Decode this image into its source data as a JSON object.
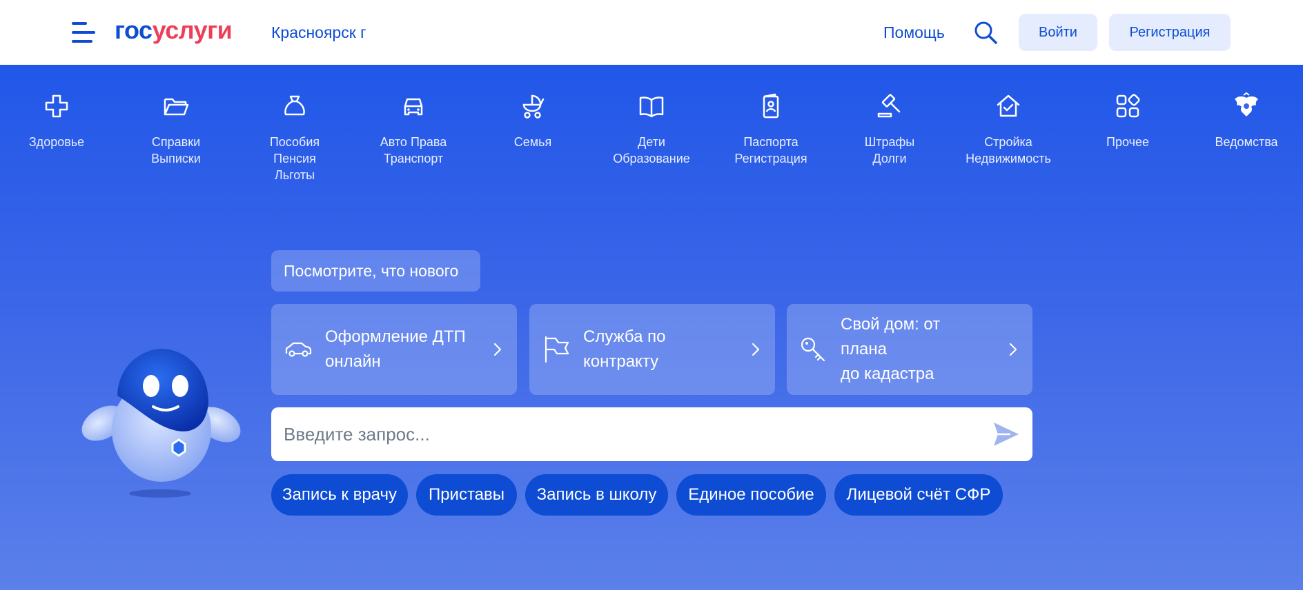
{
  "header": {
    "logo_part1": "гос",
    "logo_part2": "услуги",
    "city": "Красноярск г",
    "help": "Помощь",
    "login": "Войти",
    "register": "Регистрация"
  },
  "categories": [
    {
      "label": "Здоровье",
      "icon": "health-cross-icon"
    },
    {
      "label": "Справки\nВыписки",
      "icon": "folder-icon"
    },
    {
      "label": "Пособия\nПенсия\nЛьготы",
      "icon": "money-bag-icon"
    },
    {
      "label": "Авто Права\nТранспорт",
      "icon": "car-icon"
    },
    {
      "label": "Семья",
      "icon": "stroller-icon"
    },
    {
      "label": "Дети\nОбразование",
      "icon": "book-icon"
    },
    {
      "label": "Паспорта\nРегистрация",
      "icon": "passport-icon"
    },
    {
      "label": "Штрафы\nДолги",
      "icon": "gavel-icon"
    },
    {
      "label": "Стройка\nНедвижимость",
      "icon": "house-check-icon"
    },
    {
      "label": "Прочее",
      "icon": "grid-icon"
    },
    {
      "label": "Ведомства",
      "icon": "coat-of-arms-icon"
    }
  ],
  "whats_new": "Посмотрите, что нового",
  "cards": [
    {
      "lines": [
        "Оформление ДТП",
        "онлайн"
      ],
      "icon": "car-outline-icon"
    },
    {
      "lines": [
        "Служба по",
        "контракту"
      ],
      "icon": "flag-icon"
    },
    {
      "lines": [
        "Свой дом: от",
        "плана",
        "до кадастра"
      ],
      "icon": "key-icon"
    }
  ],
  "search": {
    "placeholder": "Введите запрос..."
  },
  "chips": [
    "Запись к врачу",
    "Приставы",
    "Запись в школу",
    "Единое пособие",
    "Лицевой счёт СФР"
  ],
  "colors": {
    "brand_blue": "#0d4cd3",
    "brand_red": "#ee3f58",
    "hero_top": "#2157e8",
    "hero_bottom": "#5b80ea",
    "button_light": "#e4ecfd"
  }
}
